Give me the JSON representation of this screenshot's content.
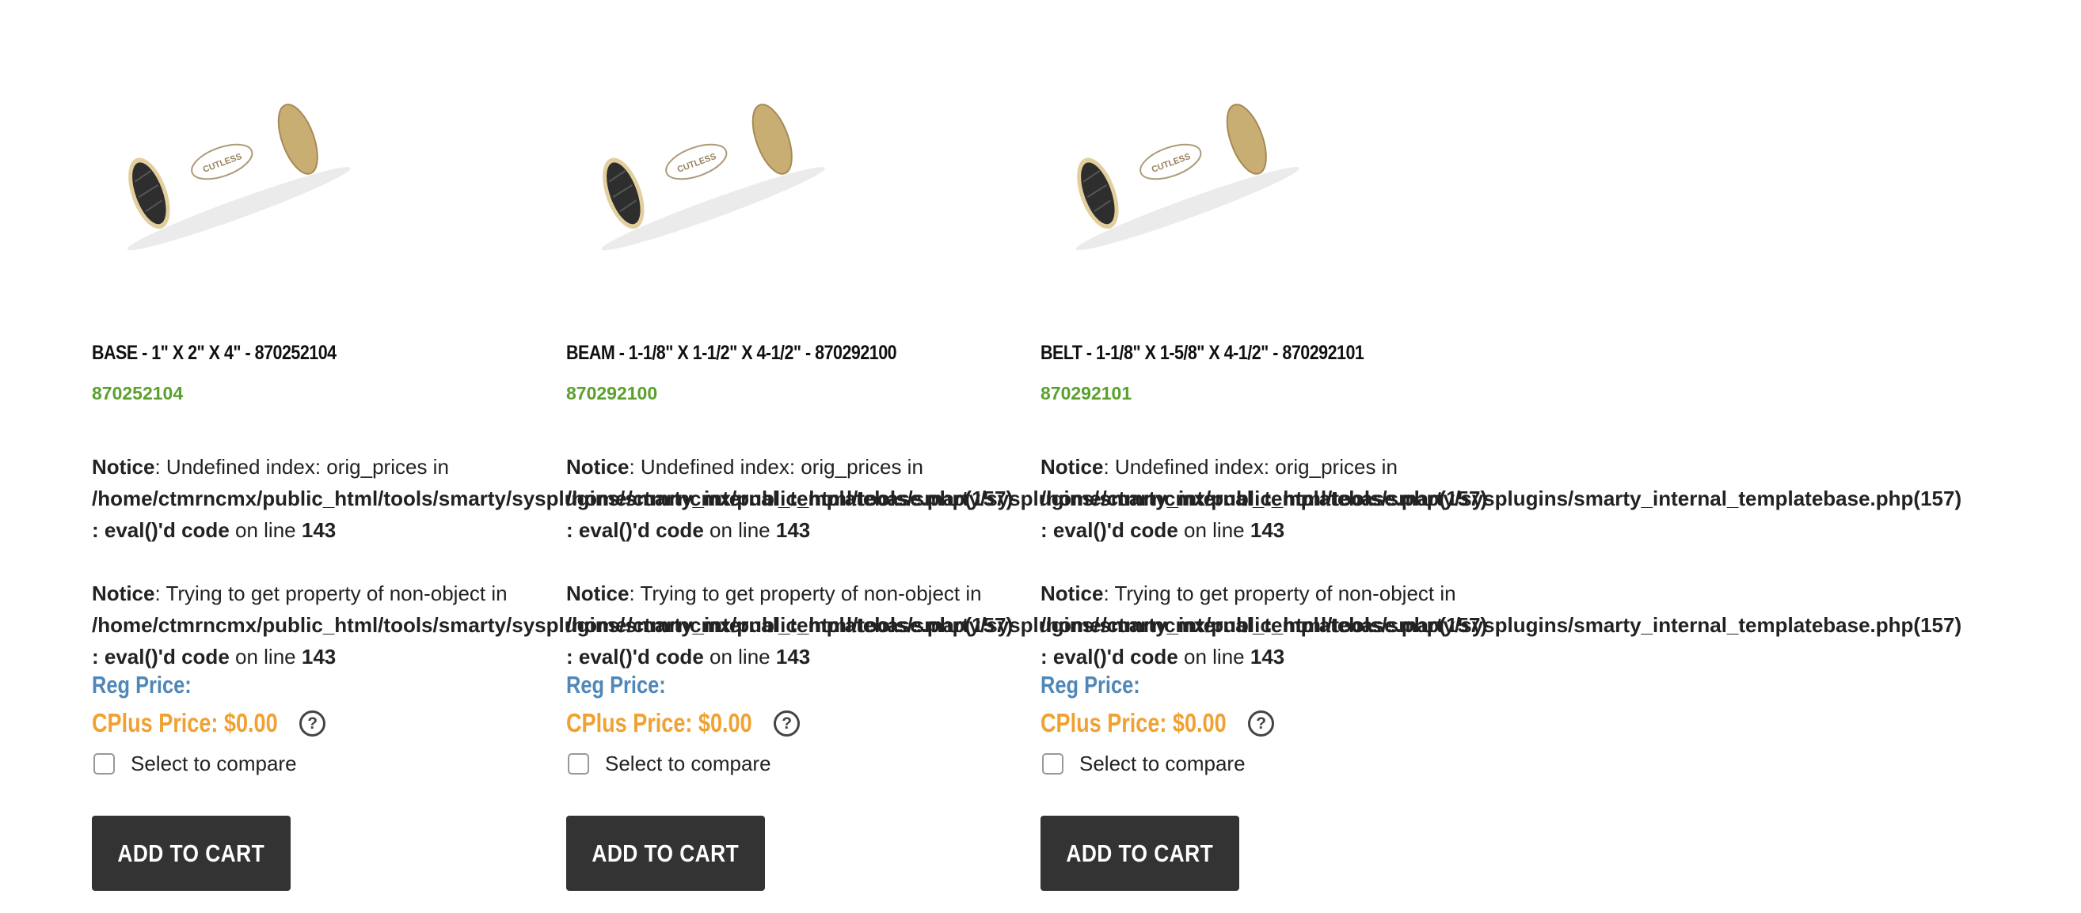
{
  "products": [
    {
      "title": "BASE - 1\" X 2\" X 4\" - 870252104",
      "sku": "870252104",
      "reg_price_label": "Reg Price:",
      "cplus_price": "CPlus Price: $0.00",
      "compare_label": "Select to compare",
      "add_to_cart": "ADD TO CART"
    },
    {
      "title": "BEAM - 1-1/8\" X 1-1/2\" X 4-1/2\" - 870292100",
      "sku": "870292100",
      "reg_price_label": "Reg Price:",
      "cplus_price": "CPlus Price: $0.00",
      "compare_label": "Select to compare",
      "add_to_cart": "ADD TO CART"
    },
    {
      "title": "BELT - 1-1/8\" X 1-5/8\" X 4-1/2\" - 870292101",
      "sku": "870292101",
      "reg_price_label": "Reg Price:",
      "cplus_price": "CPlus Price: $0.00",
      "compare_label": "Select to compare",
      "add_to_cart": "ADD TO CART"
    }
  ],
  "notices": {
    "label": "Notice",
    "undefined_index": ": Undefined index: orig_prices in",
    "non_object": ": Trying to get property of non-object in",
    "path": "/home/ctmrncmx/public_html/tools/smarty/sysplugins/smarty_internal_templatebase.php(157)",
    "eval_code": ": eval()'d code",
    "on_line": " on line ",
    "line_number": "143"
  },
  "help_icon_char": "?",
  "colors": {
    "sku_green": "#5aa02c",
    "reg_price_blue": "#4f87b8",
    "cplus_orange": "#f0a132",
    "button_dark": "#333333"
  }
}
